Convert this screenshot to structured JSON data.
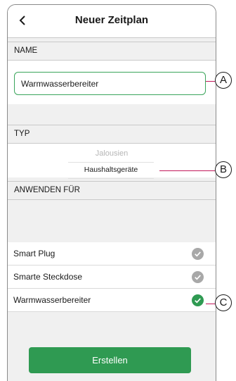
{
  "header": {
    "title": "Neuer Zeitplan",
    "back_icon": "chevron-left-icon"
  },
  "sections": {
    "name_label": "NAME",
    "typ_label": "TYP",
    "apply_label": "ANWENDEN FÜR"
  },
  "name_input": {
    "value": "Warmwasserbereiter"
  },
  "typ_picker": {
    "option_above": "Jalousien",
    "selected": "Haushaltsgeräte"
  },
  "apply_list": [
    {
      "label": "Smart Plug",
      "checked": false
    },
    {
      "label": "Smarte Steckdose",
      "checked": false
    },
    {
      "label": "Warmwasserbereiter",
      "checked": true
    }
  ],
  "create_button": {
    "label": "Erstellen"
  },
  "callouts": {
    "a": "A",
    "b": "B",
    "c": "C"
  },
  "colors": {
    "accent_green": "#2f9a52",
    "callout_line": "#c2185b",
    "unchecked_gray": "#a8a8a8"
  }
}
